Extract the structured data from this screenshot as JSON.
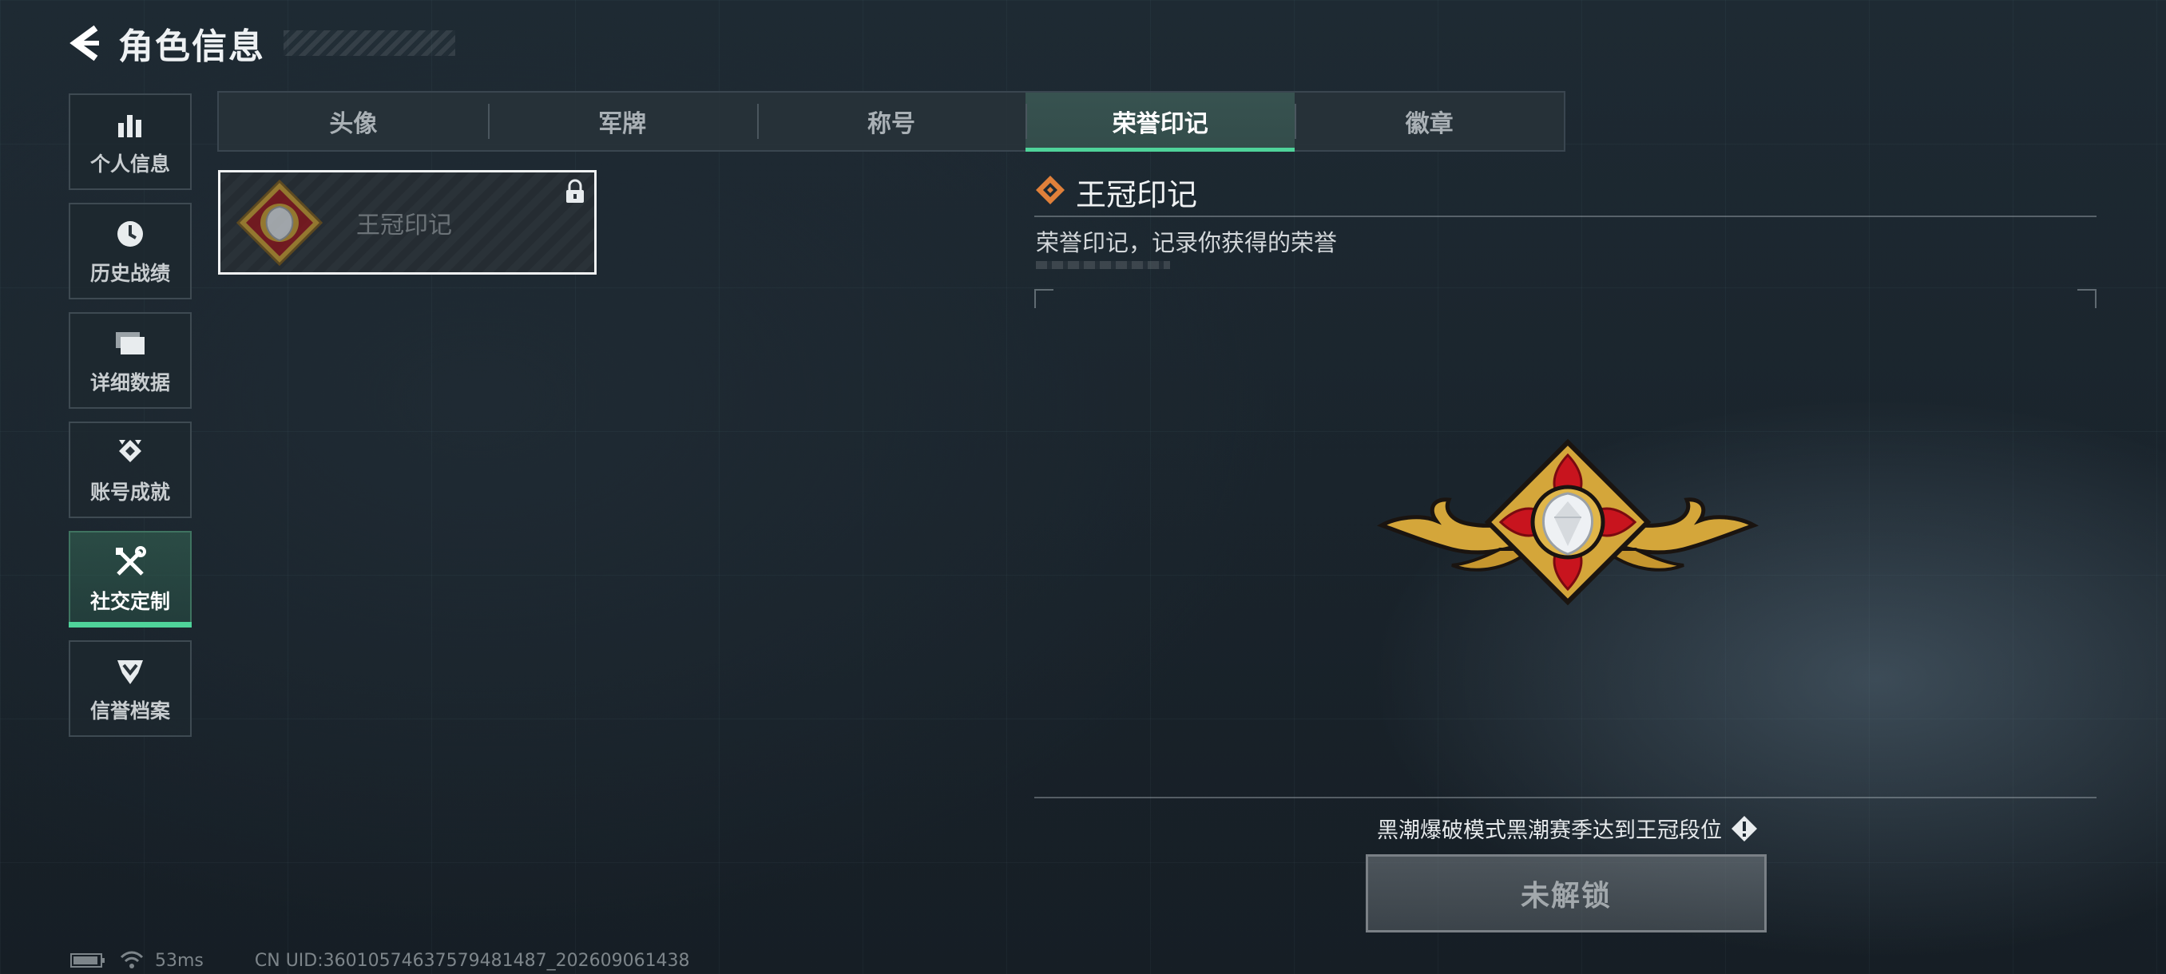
{
  "header": {
    "title": "角色信息",
    "back_icon": "back-arrow-icon"
  },
  "sidebar": {
    "items": [
      {
        "label": "个人信息",
        "icon": "bar-chart-icon",
        "active": false
      },
      {
        "label": "历史战绩",
        "icon": "clock-icon",
        "active": false
      },
      {
        "label": "详细数据",
        "icon": "folder-icon",
        "active": false
      },
      {
        "label": "账号成就",
        "icon": "achievement-icon",
        "active": false
      },
      {
        "label": "社交定制",
        "icon": "tools-icon",
        "active": true
      },
      {
        "label": "信誉档案",
        "icon": "reputation-icon",
        "active": false
      }
    ]
  },
  "tabs": {
    "items": [
      {
        "label": "头像",
        "active": false
      },
      {
        "label": "军牌",
        "active": false
      },
      {
        "label": "称号",
        "active": false
      },
      {
        "label": "荣誉印记",
        "active": true
      },
      {
        "label": "徽章",
        "active": false
      }
    ]
  },
  "item_list": {
    "items": [
      {
        "name": "王冠印记",
        "locked": true,
        "selected": true
      }
    ]
  },
  "detail": {
    "title": "王冠印记",
    "description": "荣誉印记，记录你获得的荣誉",
    "condition": "黑潮爆破模式黑潮赛季达到王冠段位",
    "button_label": "未解锁"
  },
  "footer": {
    "ping": "53ms",
    "uid": "CN UID:3601057463757948148​7_202609061438"
  },
  "colors": {
    "accent": "#4fd39a",
    "emblem_gold": "#d4a63a",
    "emblem_red": "#c8141e",
    "title_icon_orange": "#e0803a"
  }
}
